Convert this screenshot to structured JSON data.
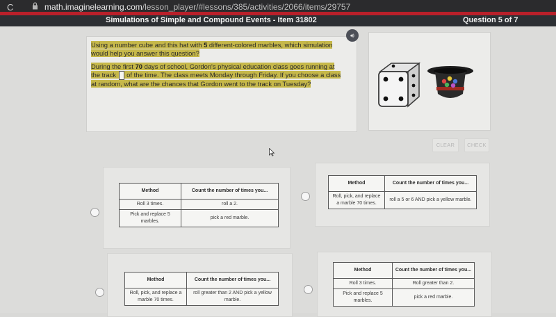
{
  "browser": {
    "url_host": "math.imaginelearning.com",
    "url_path": "/lesson_player/#lessons/385/activities/2066/items/29757"
  },
  "header": {
    "title": "Simulations of Simple and Compound Events - Item 31802",
    "question_counter": "Question 5 of 7"
  },
  "question": {
    "p1": {
      "a": "Using a number cube and this hat with ",
      "n": "5",
      "b": " different-colored marbles, which simulation would help you answer this question?"
    },
    "p2": {
      "a": "During the first ",
      "n": "70",
      "b": " days of school, Gordon's physical education class goes running at the track ",
      "c": " of the time. The class meets Monday through Friday. If you choose a class at random, what are the chances that Gordon went to the track on Tuesday?"
    }
  },
  "buttons": {
    "clear": "CLEAR",
    "check": "CHECK"
  },
  "table_headers": {
    "method": "Method",
    "count": "Count the number of times you..."
  },
  "options": [
    {
      "rows": [
        {
          "method": "Roll 3 times.",
          "count": "roll a 2."
        },
        {
          "method": "Pick and replace 5 marbles.",
          "count": "pick a red marble."
        }
      ]
    },
    {
      "rows": [
        {
          "method": "Roll, pick, and replace a marble 70 times.",
          "count": "roll a 5 or 6 AND pick a yellow marble."
        }
      ]
    },
    {
      "rows": [
        {
          "method": "Roll, pick, and replace a marble 70 times.",
          "count": "roll greater than 2 AND pick a yellow marble."
        }
      ]
    },
    {
      "rows": [
        {
          "method": "Roll 3 times.",
          "count": "Roll greater than 2."
        },
        {
          "method": "Pick and replace 5 marbles.",
          "count": "pick a red marble."
        }
      ]
    }
  ],
  "colors": {
    "header_red": "#b8202a",
    "highlight": "#c6b84a",
    "titlebar": "#2c2f33"
  }
}
